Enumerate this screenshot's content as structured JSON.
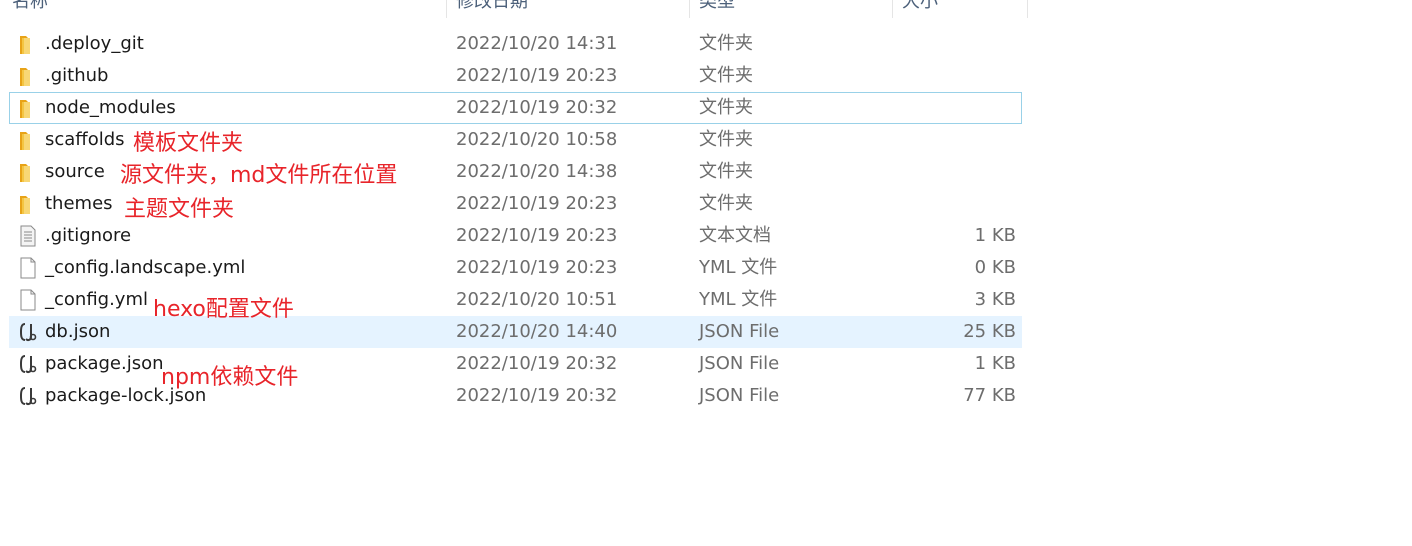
{
  "columns": {
    "name": "名称",
    "date": "修改日期",
    "type": "类型",
    "size": "大小"
  },
  "files": [
    {
      "name": ".deploy_git",
      "date": "2022/10/20 14:31",
      "type": "文件夹",
      "size": "",
      "icon": "folder-icon"
    },
    {
      "name": ".github",
      "date": "2022/10/19 20:23",
      "type": "文件夹",
      "size": "",
      "icon": "folder-icon"
    },
    {
      "name": "node_modules",
      "date": "2022/10/19 20:32",
      "type": "文件夹",
      "size": "",
      "icon": "folder-icon"
    },
    {
      "name": "scaffolds",
      "date": "2022/10/20 10:58",
      "type": "文件夹",
      "size": "",
      "icon": "folder-icon"
    },
    {
      "name": "source",
      "date": "2022/10/20 14:38",
      "type": "文件夹",
      "size": "",
      "icon": "folder-icon"
    },
    {
      "name": "themes",
      "date": "2022/10/19 20:23",
      "type": "文件夹",
      "size": "",
      "icon": "folder-icon"
    },
    {
      "name": ".gitignore",
      "date": "2022/10/19 20:23",
      "type": "文本文档",
      "size": "1 KB",
      "icon": "text-document-icon"
    },
    {
      "name": "_config.landscape.yml",
      "date": "2022/10/19 20:23",
      "type": "YML 文件",
      "size": "0 KB",
      "icon": "blank-file-icon"
    },
    {
      "name": "_config.yml",
      "date": "2022/10/20 10:51",
      "type": "YML 文件",
      "size": "3 KB",
      "icon": "blank-file-icon"
    },
    {
      "name": "db.json",
      "date": "2022/10/20 14:40",
      "type": "JSON File",
      "size": "25 KB",
      "icon": "json-file-icon"
    },
    {
      "name": "package.json",
      "date": "2022/10/19 20:32",
      "type": "JSON File",
      "size": "1 KB",
      "icon": "json-file-icon"
    },
    {
      "name": "package-lock.json",
      "date": "2022/10/19 20:32",
      "type": "JSON File",
      "size": "77 KB",
      "icon": "json-file-icon"
    }
  ],
  "selection": {
    "focused": "node_modules",
    "highlighted": "db.json"
  },
  "annotations": {
    "scaffolds": "模板文件夹",
    "source": "源文件夹，md文件所在位置",
    "themes": "主题文件夹",
    "config": "hexo配置文件",
    "package": "npm依赖文件"
  },
  "colors": {
    "annotation": "#e8242a",
    "folder": "#f4c542",
    "selected_background": "#e5f3ff",
    "focus_border": "#99d1e8"
  }
}
